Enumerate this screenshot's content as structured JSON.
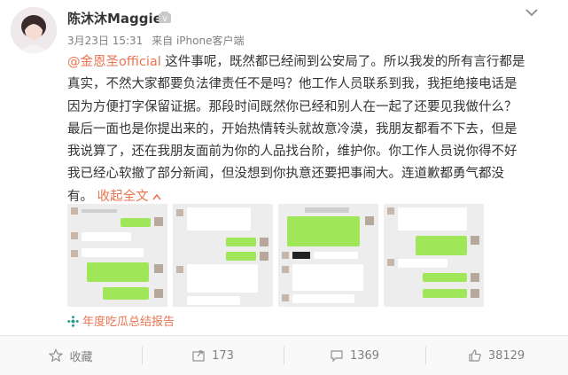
{
  "user": {
    "name": "陈沐沐Maggie"
  },
  "meta": {
    "date": "3月23日 15:31",
    "source": "来自 iPhone客户端"
  },
  "post": {
    "mention": "@金恩圣official",
    "line1_rest": " 这件事呢，既然都已经闹到公安局了。所以我发的所有言行都是",
    "line2": "真实，不然大家都要负法律责任不是吗？他工作人员联系到我，我拒绝接电话是",
    "line3": "因为方便打字保留证据。那段时间既然你已经和别人在一起了还要见我做什么？",
    "line4": "最后一面也是你提出来的，开始热情转头就故意冷漠，我朋友都看不下去，但是",
    "line5": "我说算了，还在我朋友面前为你的人品找台阶，维护你。你工作人员说你得不好",
    "line6": "我已经心软撤了部分新闻，但没想到你执意还要把事闹大。连道歉都勇气都没",
    "line7": "有。",
    "collapse": "收起全文"
  },
  "topic": "年度吃瓜总结报告",
  "actions": {
    "favorite": "收藏",
    "repost": "173",
    "comment": "1369",
    "like": "38129"
  },
  "colors": {
    "accent": "#eb7350",
    "chat_green": "#9fe658"
  }
}
